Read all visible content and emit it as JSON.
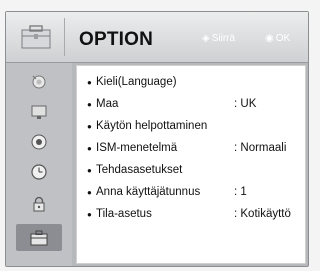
{
  "header": {
    "title": "OPTION",
    "move_hint": "Siirrä",
    "ok_hint": "OK",
    "move_glyph": "◈",
    "ok_glyph": "◉"
  },
  "sidebar": {
    "items": [
      {
        "icon": "picture-icon"
      },
      {
        "icon": "screen-icon"
      },
      {
        "icon": "audio-icon"
      },
      {
        "icon": "clock-icon"
      },
      {
        "icon": "lock-icon"
      },
      {
        "icon": "option-icon",
        "active": true
      }
    ]
  },
  "menu": {
    "items": [
      {
        "label": "Kieli(Language)",
        "value": ""
      },
      {
        "label": "Maa",
        "value": ": UK"
      },
      {
        "label": "Käytön helpottaminen",
        "value": ""
      },
      {
        "label": "ISM-menetelmä",
        "value": ": Normaali"
      },
      {
        "label": "Tehdasasetukset",
        "value": ""
      },
      {
        "label": "Anna käyttäjätunnus",
        "value": ": 1"
      },
      {
        "label": "Tila-asetus",
        "value": ": Kotikäyttö"
      }
    ]
  },
  "colors": {
    "panel": "#b7b8bb",
    "header": "#dcdddf",
    "content": "#ffffff",
    "active_tab": "#8c8d92"
  }
}
